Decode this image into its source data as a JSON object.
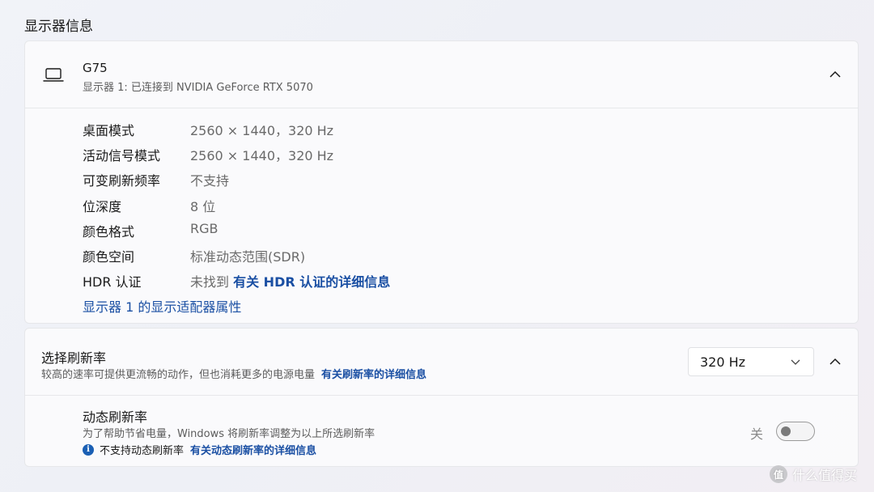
{
  "section": {
    "title": "显示器信息"
  },
  "monitor": {
    "name": "G75",
    "subtitle": "显示器 1: 已连接到 NVIDIA GeForce RTX 5070",
    "icon": "laptop-icon",
    "properties": [
      {
        "label": "桌面模式",
        "value": "2560 × 1440，320 Hz"
      },
      {
        "label": "活动信号模式",
        "value": "2560 × 1440，320 Hz"
      },
      {
        "label": "可变刷新频率",
        "value": "不支持"
      },
      {
        "label": "位深度",
        "value": "8 位"
      },
      {
        "label": "颜色格式",
        "value": "RGB"
      },
      {
        "label": "颜色空间",
        "value": "标准动态范围(SDR)"
      },
      {
        "label": "HDR 认证",
        "value": "未找到",
        "link": "有关 HDR 认证的详细信息"
      }
    ],
    "adapter_link": "显示器 1 的显示适配器属性"
  },
  "refresh_rate": {
    "title": "选择刷新率",
    "description": "较高的速率可提供更流畅的动作，但也消耗更多的电源电量",
    "link": "有关刷新率的详细信息",
    "selected": "320 Hz"
  },
  "dynamic_refresh": {
    "title": "动态刷新率",
    "description": "为了帮助节省电量，Windows 将刷新率调整为以上所选刷新率",
    "note": "不支持动态刷新率",
    "note_link": "有关动态刷新率的详细信息",
    "toggle_label": "关",
    "enabled": false
  },
  "watermark": {
    "badge": "值",
    "text": "什么值得买"
  },
  "colors": {
    "link": "#1a4fa3",
    "info": "#1a5fb4",
    "background": "#f1f3f8",
    "card": "#fbfbfc"
  }
}
